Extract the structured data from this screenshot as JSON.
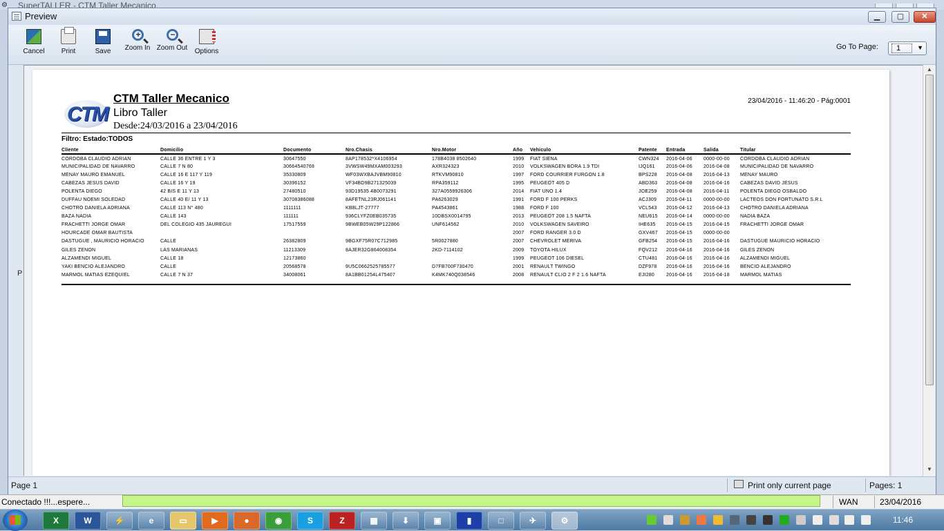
{
  "background_app": {
    "title": "SuperTALLER - CTM Taller Mecanico"
  },
  "window": {
    "title": "Preview"
  },
  "toolbar": {
    "buttons": [
      {
        "label": "Cancel",
        "icon": "cancel-icon"
      },
      {
        "label": "Print",
        "icon": "printer-icon"
      },
      {
        "label": "Save",
        "icon": "floppy-disk-icon"
      },
      {
        "label": "Zoom In",
        "icon": "zoom-in-icon"
      },
      {
        "label": "Zoom Out",
        "icon": "zoom-out-icon"
      },
      {
        "label": "Options",
        "icon": "options-icon"
      }
    ],
    "goto_label": "Go To Page:",
    "goto_value": "1"
  },
  "side_marker": "P",
  "report": {
    "logo_text": "CTM",
    "company": "CTM Taller Mecanico",
    "subtitle": "Libro Taller",
    "range": "Desde:24/03/2016 a 23/04/2016",
    "datetime": "23/04/2016 - 11:46:20 - Pág:0001",
    "filter": "Filtro: Estado:TODOS",
    "columns": [
      "Cliente",
      "Domicilio",
      "Documento",
      "Nro.Chasis",
      "Nro.Motor",
      "Año",
      "Vehiculo",
      "Patente",
      "Entrada",
      "Salida",
      "Titular"
    ],
    "rows": [
      [
        "CORDOBA CLAUDIO ADRIAN",
        "CALLE 36 ENTRE 1 Y 3",
        "30647550",
        "8AP178532*X4106954",
        "178B4038 8502640",
        "1999",
        "FIAT SIENA",
        "CWN324",
        "2016-04-06",
        "0000-00-00",
        "CORDOBA CLAUDIO ADRIAN"
      ],
      [
        "MUNICIPALIDAD DE NAVARRO",
        "CALLE 7 N 80",
        "30664540769",
        "3VWSW49MXAM003293",
        "AXR324323",
        "2010",
        "VOLKSWAGEN BORA 1.9 TDI",
        "IJQ161",
        "2016-04-06",
        "2016-04-08",
        "MUNICIPALIDAD DE NAVARRO"
      ],
      [
        "MENAY MAURO EMANUEL",
        "CALLE 16 E 117 Y 119",
        "35330809",
        "WF03WXBAJVBM90810",
        "RTKVM90810",
        "1997",
        "FORD COURRIER FURGON 1.8",
        "BPS228",
        "2016-04-08",
        "2016-04-13",
        "MENAY MAURO"
      ],
      [
        "CABEZAS JESUS DAVID",
        "CALLE 16 Y 19",
        "30396152",
        "VF34BD9B271325039",
        "RPA359112",
        "1995",
        "PEUGEOT 405 D",
        "ABD363",
        "2016-04-08",
        "2016-04-16",
        "CABEZAS DAVID JESUS"
      ],
      [
        "POLENTA DIEGO",
        "42 BIS E 11 Y 13",
        "27480510",
        "93D19535 4B0073291",
        "327A0559926306",
        "2014",
        "FIAT UNO 1.4",
        "JOE259",
        "2016-04-08",
        "2016-04-11",
        "POLENTA DIEGO OSBALDO"
      ],
      [
        "DUFFAU NOEMI SOLEDAD",
        "CALLE 40 E/ 11 Y 13",
        "30708386088",
        "8AFETNL23RJ061141",
        "PA6263029",
        "1991",
        "FORD F 100 PERKS",
        "ACJ309",
        "2016-04-11",
        "0000-00-00",
        "LACTEOS DON FORTUNATO S.R.L"
      ],
      [
        "CHOTRO DANIELA ADRIANA",
        "CALLE 113 N° 480",
        "1111111",
        "KB8LJT-27777",
        "PA4543861",
        "1988",
        "FORD F 100",
        "VCL543",
        "2016-04-12",
        "2016-04-13",
        "CHOTRO DANIELA ADRIANA"
      ],
      [
        "BAZA NADIA",
        "CALLE 143",
        "111111",
        "936CLYFZ0EB035735",
        "10DBSX0014795",
        "2013",
        "PEUGEOT 208 1.5 NAFTA",
        "NEU615",
        "2016-04-14",
        "0000-00-00",
        "NADIA BAZA"
      ],
      [
        "FRACHETTI JORGE OMAR",
        "DEL COLEGIO 435 JAUREGUI",
        "17517559",
        "9BWEB05W29P122866",
        "UNF614562",
        "2010",
        "VOLKSWAGEN SAVEIRO",
        "IHE635",
        "2016-04-15",
        "2016-04-15",
        "FRACHETTI JORGE OMAR"
      ],
      [
        "HOURCADE OMAR BAUTISTA",
        "",
        "",
        "",
        "",
        "2007",
        "FORD RANGER 3.0 D",
        "GXV467",
        "2016-04-15",
        "0000-00-00",
        ""
      ],
      [
        "DASTUGUE , MAURICIO HORACIO",
        "CALLE",
        "26382809",
        "9BGXF75R07C712985",
        "5R0027880",
        "2007",
        "CHEVROLET MERIVA",
        "GFB254",
        "2016-04-15",
        "2016-04-16",
        "DASTUGUE MAURICIO HORACIO"
      ],
      [
        "GILES ZENON",
        "LAS MARIANAS",
        "11213309",
        "8AJER32G864008354",
        "2KD-7114102",
        "2009",
        "TOYOTA HILUX",
        "FQV212",
        "2016-04-16",
        "2016-04-16",
        "GILES ZENON"
      ],
      [
        "ALZAMENDI MIGUEL",
        "CALLE 18",
        "12173860",
        "",
        "",
        "1999",
        "PEUGEOT 106 DIESEL",
        "CTU481",
        "2016-04-16",
        "2016-04-16",
        "ALZAMENDI MIGUEL"
      ],
      [
        "YAKI BENCIO ALEJANDRO",
        "CALLE",
        "20568578",
        "9U5C0662525785577",
        "D7FB700F730470",
        "2001",
        "RENAULT TWINGO",
        "DZF978",
        "2016-04-16",
        "2016-04-16",
        "BENCIO ALEJANDRO"
      ],
      [
        "MARMOL MATIAS EZEQUIEL",
        "CALLE 7 N 37",
        "34008061",
        "8A1BB01254L475407",
        "K4MK740Q038546",
        "2008",
        "RENAULT CLIO 2 F 2 1.6 NAFTA",
        "EJI280",
        "2016-04-16",
        "2016-04-18",
        "MARMOL MATIAS"
      ]
    ]
  },
  "statusbar": {
    "page": "Page 1",
    "print_current": "Print only current page",
    "pages": "Pages: 1"
  },
  "appstatus": {
    "message": "Conectado !!!...espere...",
    "network": "WAN",
    "date": "23/04/2016"
  },
  "taskbar": {
    "clock": "11:46"
  }
}
